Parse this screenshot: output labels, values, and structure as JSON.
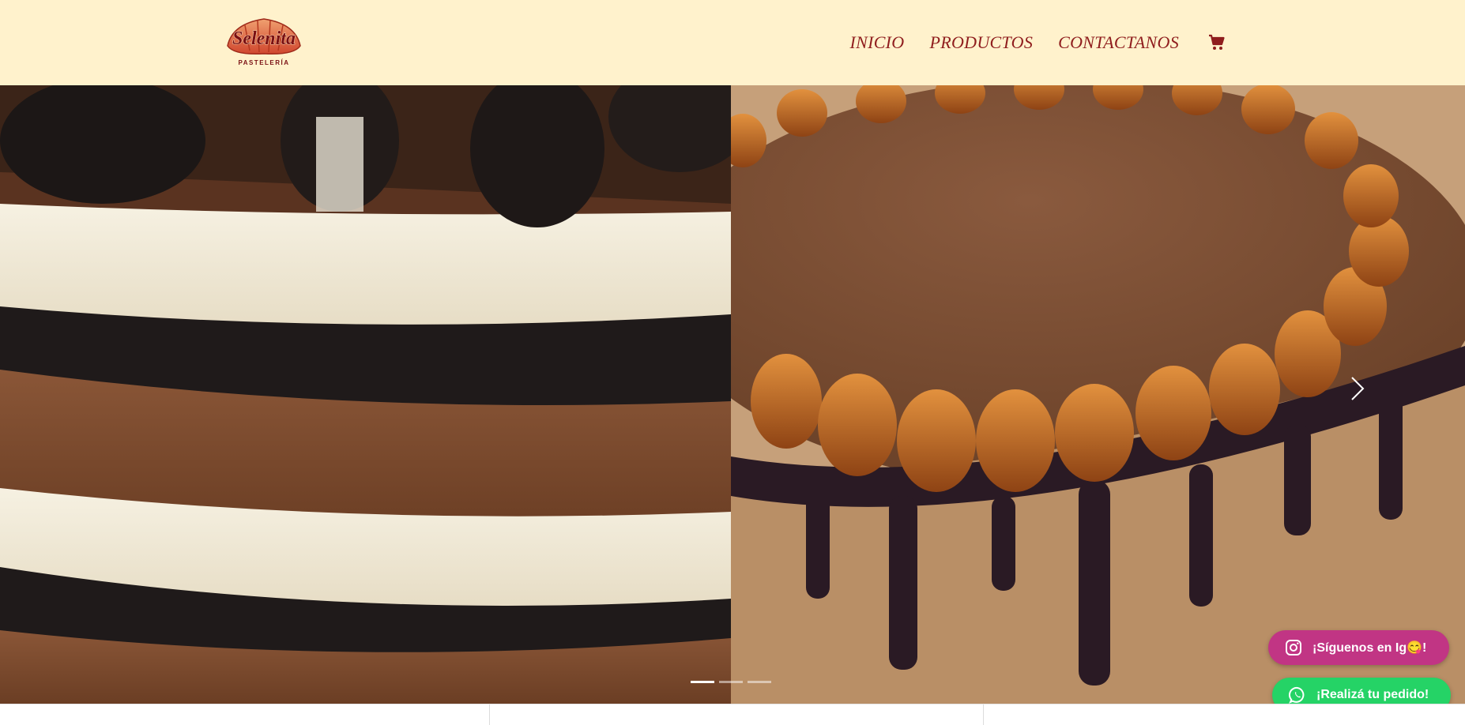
{
  "brand": {
    "name": "Selenita",
    "tagline": "PASTELERÍA"
  },
  "nav": {
    "items": [
      {
        "label": "INICIO"
      },
      {
        "label": "PRODUCTOS"
      },
      {
        "label": "CONTACTANOS"
      }
    ],
    "cart_icon": "cart-icon"
  },
  "carousel": {
    "active_index": 0,
    "indicator_count": 3,
    "next_icon": "chevron-right-icon"
  },
  "floating": {
    "instagram_label": "¡Síguenos en Ig😋!",
    "whatsapp_label": "¡Realizá tu pedido!"
  },
  "colors": {
    "header_bg": "#fff2cc",
    "nav_text": "#8f1d1d",
    "instagram": "#c13584",
    "whatsapp": "#25d366"
  }
}
